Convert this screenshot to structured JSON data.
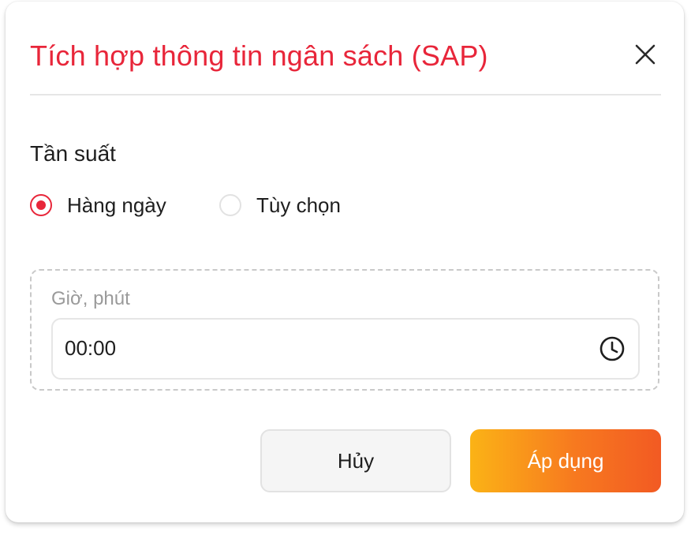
{
  "dialog": {
    "title": "Tích hợp thông tin ngân sách (SAP)",
    "close_icon": "close-icon"
  },
  "frequency": {
    "label": "Tần suất",
    "options": [
      {
        "label": "Hàng ngày",
        "selected": true
      },
      {
        "label": "Tùy chọn",
        "selected": false
      }
    ]
  },
  "time_field": {
    "label": "Giờ, phút",
    "value": "00:00",
    "icon": "clock-icon"
  },
  "actions": {
    "cancel_label": "Hủy",
    "apply_label": "Áp dụng"
  },
  "colors": {
    "accent": "#e8263a",
    "apply_gradient_start": "#fbb316",
    "apply_gradient_end": "#f25a23"
  }
}
